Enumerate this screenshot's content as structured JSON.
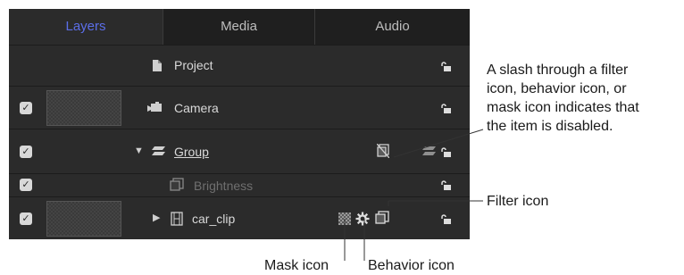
{
  "tabs": [
    {
      "label": "Layers",
      "selected": true
    },
    {
      "label": "Media",
      "selected": false
    },
    {
      "label": "Audio",
      "selected": false
    }
  ],
  "layers": [
    {
      "name": "Project",
      "icon": "project-document-icon",
      "checkbox": false
    },
    {
      "name": "Camera",
      "icon": "camera-icon",
      "checkbox": true
    },
    {
      "name": "Group",
      "icon": "group-layers-icon",
      "checkbox": true,
      "disclosure": "expanded"
    },
    {
      "name": "Brightness",
      "icon": "filter-icon",
      "checkbox": true,
      "disabled": true
    },
    {
      "name": "car_clip",
      "icon": "film-clip-icon",
      "checkbox": true,
      "disclosure": "collapsed"
    }
  ],
  "annotations": {
    "disabled_note": [
      "A slash through a filter",
      "icon, behavior icon, or",
      "mask icon indicates that",
      "the item is disabled."
    ],
    "filter_icon": "Filter icon",
    "mask_icon": "Mask icon",
    "behavior_icon": "Behavior icon"
  },
  "colors": {
    "panel_bg": "#2b2b2b",
    "tab_bar_bg": "#1f1f1f",
    "selected_tab": "#5b6ee8",
    "text": "#d9d9d9",
    "disabled_text": "#6f6f6f"
  }
}
